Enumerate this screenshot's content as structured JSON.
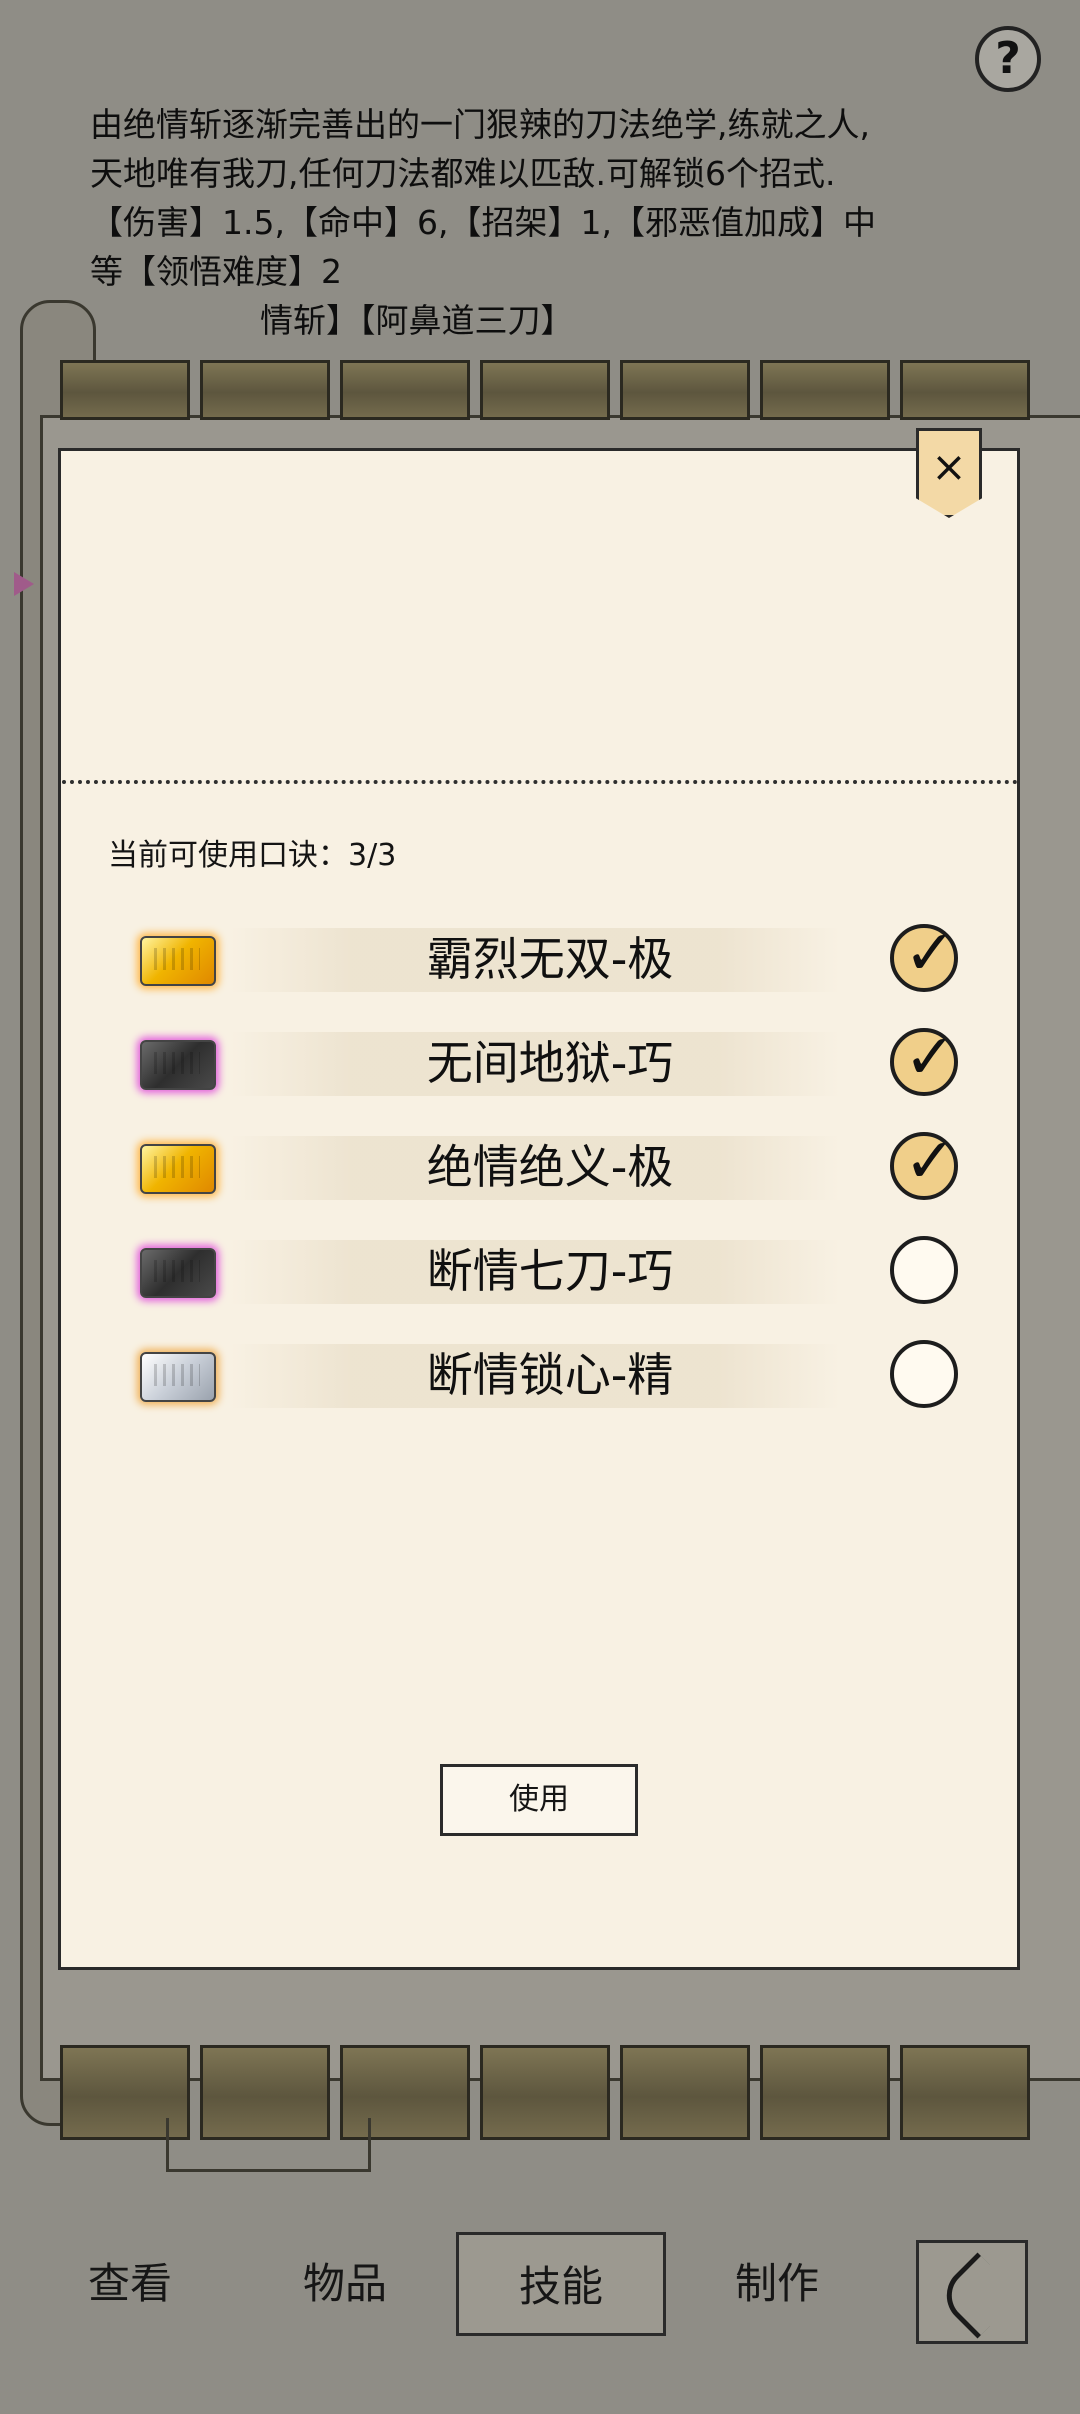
{
  "background": {
    "description_lines": [
      "由绝情斩逐渐完善出的一门狠辣的刀法绝学,练就之人,",
      "天地唯有我刀,任何刀法都难以匹敌.可解锁6个招式.",
      "【伤害】1.5,【命中】6,【招架】1,【邪恶值加成】中",
      "等【领悟难度】2",
      "情斩】【阿鼻道三刀】"
    ],
    "help_label": "?"
  },
  "modal": {
    "close_label": "×",
    "uses_label": "当前可使用口诀：3/3",
    "skills": [
      {
        "name": "霸烈无双-极",
        "gem": "gold",
        "checked": true
      },
      {
        "name": "无间地狱-巧",
        "gem": "dark",
        "checked": true
      },
      {
        "name": "绝情绝义-极",
        "gem": "gold",
        "checked": true
      },
      {
        "name": "断情七刀-巧",
        "gem": "dark",
        "checked": false
      },
      {
        "name": "断情锁心-精",
        "gem": "silver",
        "checked": false
      }
    ],
    "check_glyph": "✓",
    "use_button_label": "使用"
  },
  "bottom_nav": {
    "tabs": [
      {
        "label": "查看",
        "active": false
      },
      {
        "label": "物品",
        "active": false
      },
      {
        "label": "技能",
        "active": true
      },
      {
        "label": "制作",
        "active": false
      }
    ],
    "back_icon": "back-chevron-icon"
  },
  "colors": {
    "modal_bg": "#f8f1e3",
    "checked_fill": "#f0cf8a",
    "gold_gem": "#f0b400",
    "dark_gem_glow": "#e35fdc",
    "page_bg": "#8f8d86"
  }
}
